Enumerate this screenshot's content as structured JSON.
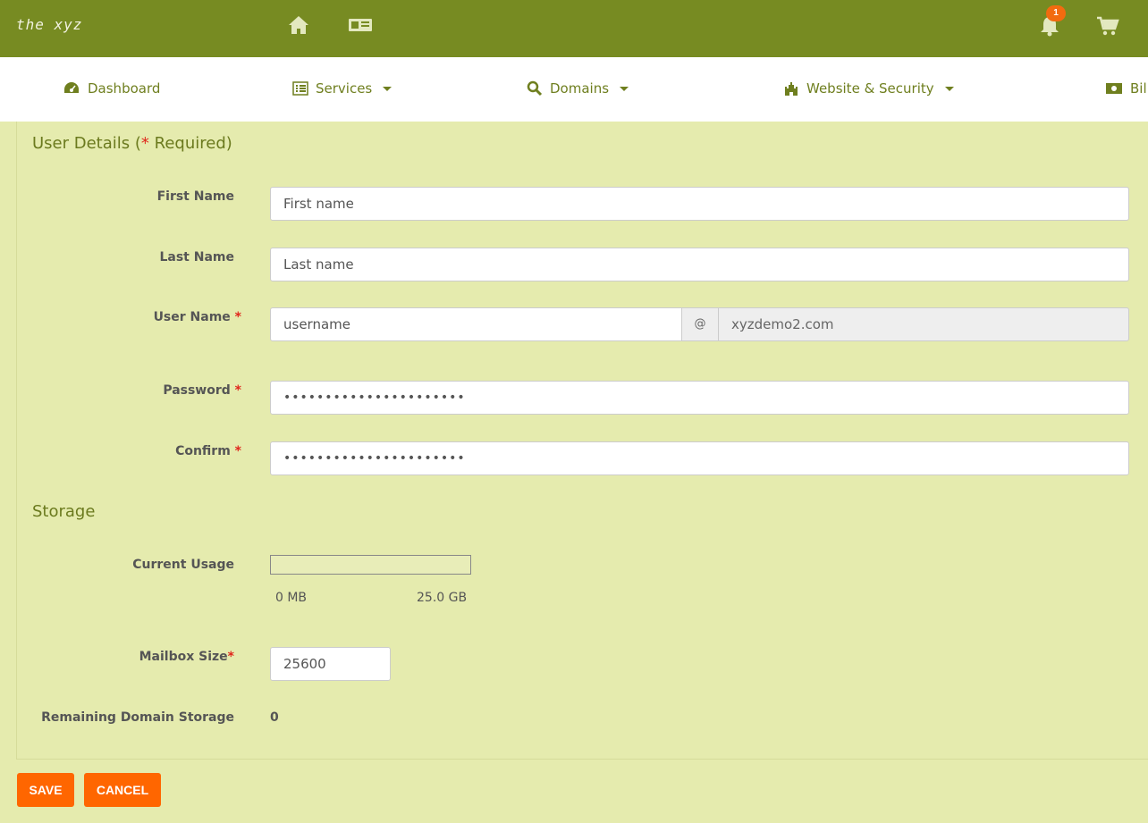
{
  "header": {
    "logo_text": "the xyz",
    "notification_count": "1",
    "icons": [
      "home-icon",
      "id-card-icon",
      "bell-icon",
      "cart-icon"
    ]
  },
  "nav": {
    "items": [
      {
        "label": "Dashboard",
        "icon": "dashboard-icon",
        "has_dropdown": false
      },
      {
        "label": "Services",
        "icon": "list-icon",
        "has_dropdown": true
      },
      {
        "label": "Domains",
        "icon": "search-icon",
        "has_dropdown": true
      },
      {
        "label": "Website & Security",
        "icon": "castle-icon",
        "has_dropdown": true
      },
      {
        "label": "Bil",
        "icon": "money-icon",
        "has_dropdown": false
      }
    ]
  },
  "user_details": {
    "title": "User Details (",
    "required_mark": "*",
    "title_suffix": " Required)",
    "first_name": {
      "label": "First Name",
      "value": "First name"
    },
    "last_name": {
      "label": "Last Name",
      "value": "Last name"
    },
    "user_name": {
      "label": "User Name",
      "required": "*",
      "value": "username",
      "at": "@",
      "domain": "xyzdemo2.com"
    },
    "password": {
      "label": "Password",
      "required": "*",
      "value": "••••••••••••••••••••••"
    },
    "confirm": {
      "label": "Confirm",
      "required": "*",
      "value": "••••••••••••••••••••••"
    }
  },
  "storage": {
    "title": "Storage",
    "current_usage": {
      "label": "Current Usage",
      "min": "0 MB",
      "max": "25.0 GB",
      "fraction": 0
    },
    "mailbox_size": {
      "label": "Mailbox Size",
      "required": "*",
      "value": "25600"
    },
    "remaining": {
      "label": "Remaining Domain Storage",
      "value": "0"
    }
  },
  "actions": {
    "save": "SAVE",
    "cancel": "CANCEL"
  },
  "colors": {
    "header_bg": "#778b22",
    "page_bg": "#e5ebae",
    "accent_orange": "#ff6600",
    "required_red": "#e0261c"
  }
}
